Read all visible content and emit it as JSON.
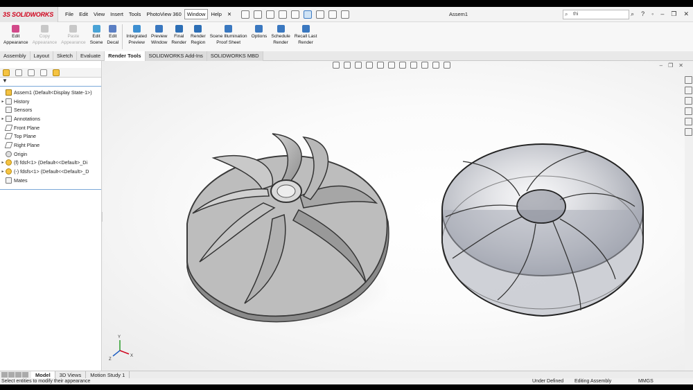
{
  "app": {
    "brand_prefix": "3S",
    "brand_name": "SOLIDWORKS",
    "document_title": "Assem1",
    "search_placeholder": "thi"
  },
  "menu": [
    "File",
    "Edit",
    "View",
    "Insert",
    "Tools",
    "PhotoView 360",
    "Window",
    "Help"
  ],
  "ribbon": {
    "buttons": [
      {
        "label1": "Edit",
        "label2": "Appearance",
        "icon": "edit-appearance-icon",
        "color": "#d24a8a",
        "enabled": true
      },
      {
        "label1": "Copy",
        "label2": "Appearance",
        "icon": "copy-appearance-icon",
        "color": "#c8c8c8",
        "enabled": false
      },
      {
        "label1": "Paste",
        "label2": "Appearance",
        "icon": "paste-appearance-icon",
        "color": "#c8c8c8",
        "enabled": false
      },
      {
        "label1": "Edit",
        "label2": "Scene",
        "icon": "edit-scene-icon",
        "color": "#4aa3d6",
        "enabled": true
      },
      {
        "label1": "Edit",
        "label2": "Decal",
        "icon": "edit-decal-icon",
        "color": "#5b7fc4",
        "enabled": true
      },
      {
        "label1": "Integrated",
        "label2": "Preview",
        "icon": "integrated-preview-icon",
        "color": "#3d8fd1",
        "enabled": true
      },
      {
        "label1": "Preview",
        "label2": "Window",
        "icon": "preview-window-icon",
        "color": "#3a78c0",
        "enabled": true
      },
      {
        "label1": "Final",
        "label2": "Render",
        "icon": "final-render-icon",
        "color": "#2d6fb6",
        "enabled": true
      },
      {
        "label1": "Render",
        "label2": "Region",
        "icon": "render-region-icon",
        "color": "#2d6fb6",
        "enabled": true
      },
      {
        "label1": "Scene Illumination",
        "label2": "Proof Sheet",
        "icon": "proof-sheet-icon",
        "color": "#3a78c0",
        "enabled": true
      },
      {
        "label1": "Options",
        "label2": "",
        "icon": "options-icon",
        "color": "#3a78c0",
        "enabled": true
      },
      {
        "label1": "Schedule",
        "label2": "Render",
        "icon": "schedule-render-icon",
        "color": "#3a78c0",
        "enabled": true
      },
      {
        "label1": "Recall Last",
        "label2": "Render",
        "icon": "recall-render-icon",
        "color": "#3a78c0",
        "enabled": true
      }
    ]
  },
  "tabs": [
    "Assembly",
    "Layout",
    "Sketch",
    "Evaluate",
    "Render Tools",
    "SOLIDWORKS Add-Ins",
    "SOLIDWORKS MBD"
  ],
  "active_tab": "Render Tools",
  "tree": {
    "root": "Assem1  (Default<Display State-1>)",
    "items": [
      {
        "label": "History",
        "icon": "history-icon",
        "expandable": true
      },
      {
        "label": "Sensors",
        "icon": "sensors-icon",
        "expandable": false
      },
      {
        "label": "Annotations",
        "icon": "annotations-icon",
        "expandable": true
      },
      {
        "label": "Front Plane",
        "icon": "plane-icon",
        "expandable": false
      },
      {
        "label": "Top Plane",
        "icon": "plane-icon",
        "expandable": false
      },
      {
        "label": "Right Plane",
        "icon": "plane-icon",
        "expandable": false
      },
      {
        "label": "Origin",
        "icon": "origin-icon",
        "expandable": false
      },
      {
        "label": "(f) fdsf<1> (Default<<Default>_Di",
        "icon": "part-icon",
        "expandable": true
      },
      {
        "label": "(-) fdsfs<1> (Default<<Default>_D",
        "icon": "part-icon",
        "expandable": true
      },
      {
        "label": "Mates",
        "icon": "mates-icon",
        "expandable": false
      }
    ]
  },
  "bottom_tabs": [
    "Model",
    "3D Views",
    "Motion Study 1"
  ],
  "active_bottom_tab": "Model",
  "status": {
    "message": "Select entities to modify their appearance",
    "definition": "Under Defined",
    "mode": "Editing Assembly",
    "units": "MMGS"
  },
  "triad_labels": {
    "y": "Y",
    "x": "X",
    "z": "Z"
  },
  "colors": {
    "brand_red": "#d0021b",
    "tree_accent": "#7aa8d8",
    "part_gray": "#a9a9a9",
    "glass": "#9aa0ad"
  }
}
